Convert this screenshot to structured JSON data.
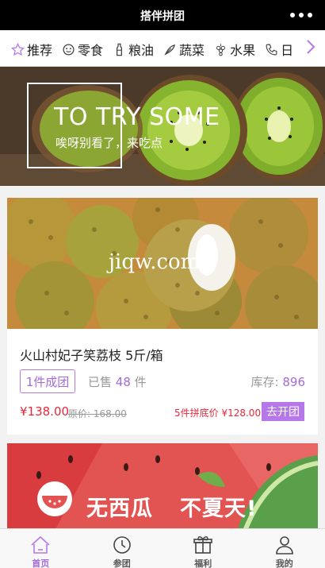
{
  "app": {
    "title": "搭伴拼团"
  },
  "categories": [
    {
      "label": "推荐",
      "icon": "star-icon"
    },
    {
      "label": "零食",
      "icon": "snack-icon"
    },
    {
      "label": "粮油",
      "icon": "oil-bottle-icon"
    },
    {
      "label": "蔬菜",
      "icon": "vegetable-icon"
    },
    {
      "label": "水果",
      "icon": "grapes-icon"
    },
    {
      "label": "日",
      "icon": "phone-icon"
    }
  ],
  "banner": {
    "headline": "TO TRY SOME",
    "subline": "唉呀别看了，来吃点"
  },
  "product": {
    "watermark": "jiqw.com",
    "name": "火山村妃子笑荔枝 5斤/箱",
    "group_badge": "1件成团",
    "sold_prefix": "已售",
    "sold_count": "48",
    "sold_suffix": "件",
    "stock_label": "库存:",
    "stock_value": "896",
    "price": "¥138.00",
    "original_price": "原价: 168.00",
    "group_price": "5件拼底价 ¥128.00",
    "open_group_button": "去开团"
  },
  "promo": {
    "slogan_1": "无西瓜",
    "slogan_2": "不夏天!"
  },
  "tabs": [
    {
      "label": "首页",
      "icon": "home-icon",
      "active": true
    },
    {
      "label": "参团",
      "icon": "clock-icon",
      "active": false
    },
    {
      "label": "福利",
      "icon": "gift-icon",
      "active": false
    },
    {
      "label": "我的",
      "icon": "user-icon",
      "active": false
    }
  ],
  "colors": {
    "accent": "#b678e8",
    "price_red": "#e8273a",
    "titlebar": "#000000"
  }
}
